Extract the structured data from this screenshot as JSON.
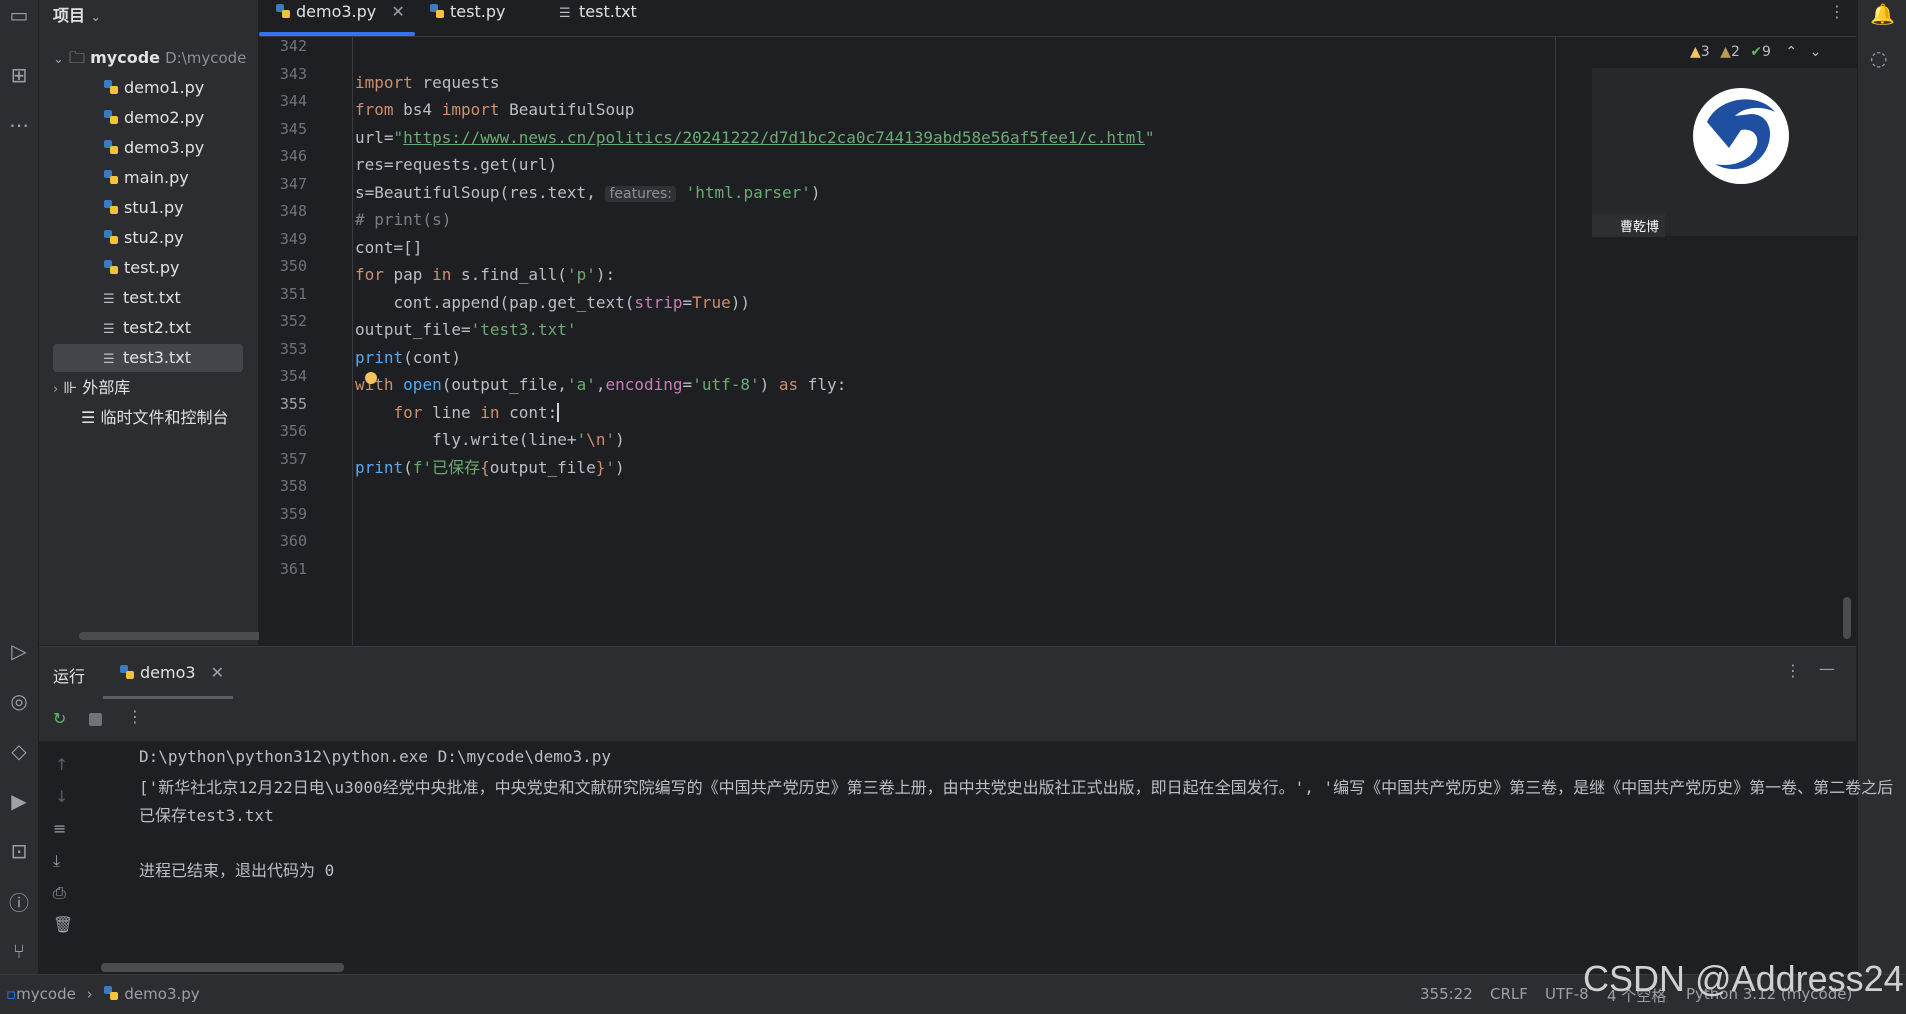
{
  "project_panel": {
    "title": "项目",
    "root": {
      "name": "mycode",
      "path": "D:\\mycode"
    },
    "files": [
      {
        "name": "demo1.py",
        "type": "py"
      },
      {
        "name": "demo2.py",
        "type": "py"
      },
      {
        "name": "demo3.py",
        "type": "py"
      },
      {
        "name": "main.py",
        "type": "py"
      },
      {
        "name": "stu1.py",
        "type": "py"
      },
      {
        "name": "stu2.py",
        "type": "py"
      },
      {
        "name": "test.py",
        "type": "py"
      },
      {
        "name": "test.txt",
        "type": "txt"
      },
      {
        "name": "test2.txt",
        "type": "txt"
      },
      {
        "name": "test3.txt",
        "type": "txt",
        "selected": true
      }
    ],
    "external_libs": "外部库",
    "scratches": "临时文件和控制台"
  },
  "tabs": [
    {
      "label": "demo3.py",
      "active": true,
      "closable": true
    },
    {
      "label": "test.py",
      "active": false
    },
    {
      "label": "test.txt",
      "active": false
    }
  ],
  "inspections": {
    "warnings": "3",
    "weak_warnings": "2",
    "typos": "9"
  },
  "editor": {
    "line_numbers": [
      "342",
      "343",
      "344",
      "345",
      "346",
      "347",
      "348",
      "349",
      "350",
      "351",
      "352",
      "353",
      "354",
      "355",
      "356",
      "357",
      "358",
      "359",
      "360",
      "361"
    ],
    "current_line": "355",
    "param_hint": "features:",
    "url": "https://www.news.cn/politics/20241222/d7d1bc2ca0c744139abd58e56af5fee1/c.html"
  },
  "avatar": {
    "name": "曹乾博"
  },
  "run_panel": {
    "title": "运行",
    "tab": "demo3",
    "output": [
      "D:\\python\\python312\\python.exe D:\\mycode\\demo3.py",
      "['新华社北京12月22日电\\u3000经党中央批准，中央党史和文献研究院编写的《中国共产党历史》第三卷上册，由中共党史出版社正式出版，即日起在全国发行。', '编写《中国共产党历史》第三卷，是继《中国共产党历史》第一卷、第二卷之后",
      "已保存test3.txt",
      "",
      "进程已结束，退出代码为 0"
    ]
  },
  "status_bar": {
    "breadcrumb_root": "mycode",
    "breadcrumb_file": "demo3.py",
    "position": "355:22",
    "line_sep": "CRLF",
    "encoding": "UTF-8",
    "indent": "4 个空格",
    "interpreter": "Python 3.12 (mycode)"
  },
  "watermark": "CSDN @Address24",
  "colors": {
    "accent": "#3574f0",
    "keyword": "#cf8e6d",
    "string": "#6aab73",
    "function": "#56a8f5",
    "param": "#c77dbb"
  }
}
